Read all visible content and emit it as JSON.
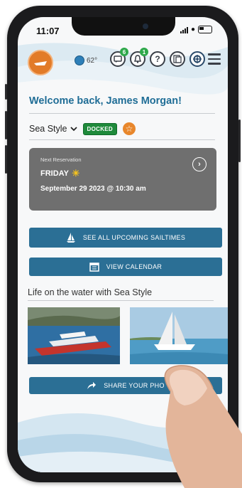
{
  "status_bar": {
    "time": "11:07"
  },
  "header": {
    "temperature": "62°",
    "chat_badge": "6",
    "notification_badge": "1",
    "help_icon_glyph": "?"
  },
  "welcome_text": "Welcome back, James Morgan!",
  "boat": {
    "name": "Sea Style",
    "status": "DOCKED"
  },
  "reservation": {
    "label": "Next Reservation",
    "day": "FRIDAY",
    "datetime": "September 29 2023 @ 10:30 am"
  },
  "buttons": {
    "upcoming": "SEE ALL UPCOMING SAILTIMES",
    "calendar": "VIEW CALENDAR",
    "share": "SHARE YOUR PHO"
  },
  "section_title": "Life on the water with Sea Style",
  "colors": {
    "accent_blue": "#2b6f95",
    "welcome_blue": "#1f6d96",
    "docked_green": "#1f8a3b",
    "logo_orange": "#e27b28",
    "card_gray": "#6f6f6f"
  },
  "icons": [
    "weather-icon",
    "chat-icon",
    "bell-icon",
    "help-icon",
    "document-icon",
    "boat-wheel-icon",
    "menu-icon",
    "star-icon",
    "sailboat-icon",
    "calendar-icon",
    "share-arrow-icon",
    "chevron-right-icon"
  ]
}
